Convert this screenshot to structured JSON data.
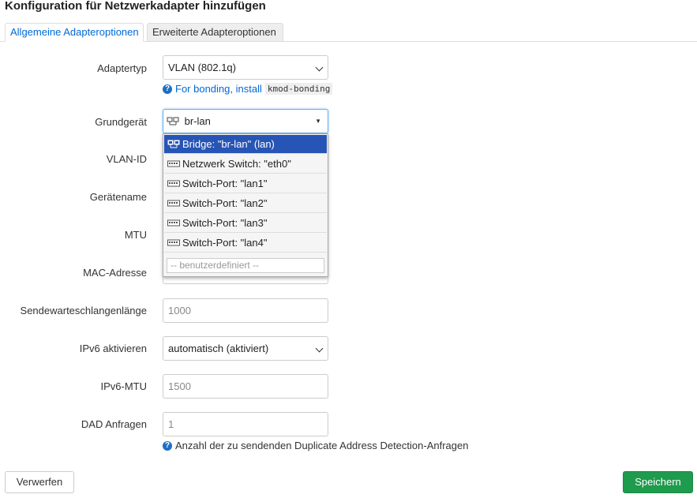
{
  "title": "Konfiguration für Netzwerkadapter hinzufügen",
  "tabs": [
    {
      "label": "Allgemeine Adapteroptionen"
    },
    {
      "label": "Erweiterte Adapteroptionen"
    }
  ],
  "fields": {
    "adaptertyp": {
      "label": "Adaptertyp",
      "value": "VLAN (802.1q)"
    },
    "bonding_help": {
      "text": "For bonding, install",
      "code": "kmod-bonding"
    },
    "grundgeraet": {
      "label": "Grundgerät",
      "value": "br-lan"
    },
    "vlan_id": {
      "label": "VLAN-ID"
    },
    "geraetename": {
      "label": "Gerätename"
    },
    "mtu": {
      "label": "MTU"
    },
    "mac": {
      "label": "MAC-Adresse"
    },
    "sendewarteschlange": {
      "label": "Sendewarteschlangenlänge",
      "placeholder": "1000"
    },
    "ipv6": {
      "label": "IPv6 aktivieren",
      "value": "automatisch (aktiviert)"
    },
    "ipv6_mtu": {
      "label": "IPv6-MTU",
      "placeholder": "1500"
    },
    "dad": {
      "label": "DAD Anfragen",
      "placeholder": "1",
      "help": "Anzahl der zu sendenden Duplicate Address Detection-Anfragen"
    }
  },
  "dropdown": {
    "options": [
      {
        "label": "Bridge: \"br-lan\" (lan)",
        "icon": "bridge-icon",
        "selected": true
      },
      {
        "label": "Netzwerk Switch: \"eth0\"",
        "icon": "switch-icon"
      },
      {
        "label": "Switch-Port: \"lan1\"",
        "icon": "switch-icon"
      },
      {
        "label": "Switch-Port: \"lan2\"",
        "icon": "switch-icon"
      },
      {
        "label": "Switch-Port: \"lan3\"",
        "icon": "switch-icon"
      },
      {
        "label": "Switch-Port: \"lan4\"",
        "icon": "switch-icon"
      }
    ],
    "custom_placeholder": "-- benutzerdefiniert --"
  },
  "buttons": {
    "discard": "Verwerfen",
    "save": "Speichern"
  },
  "colors": {
    "accent": "#0069d6",
    "save": "#1e9b4c",
    "selected": "#2755b6"
  }
}
